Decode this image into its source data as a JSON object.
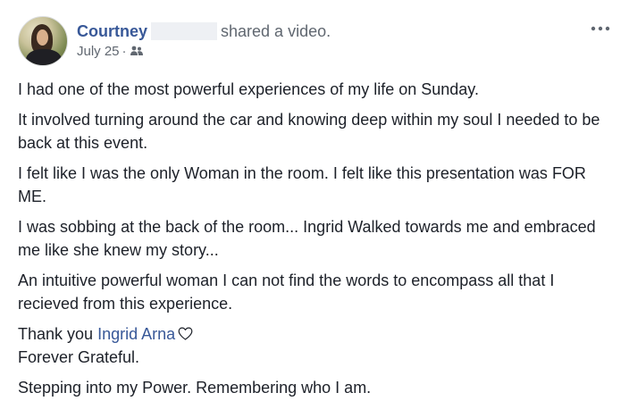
{
  "post": {
    "author": "Courtney",
    "action": "shared a video.",
    "date": "July 25",
    "date_separator": "·",
    "audience_icon": "friends-icon",
    "more_icon": "more-options-icon",
    "paragraphs": [
      "I had one of the most powerful experiences of my life on Sunday.",
      "It involved turning around the car and knowing deep within my soul I needed to be back at this event.",
      "I felt like I was the only Woman in the room. I felt like this presentation was FOR ME.",
      "I was sobbing at the back of the room... Ingrid Walked towards me and embraced me like she knew my story...",
      "An intuitive powerful woman I can not find the words to encompass all that I recieved from this experience."
    ],
    "thanks_prefix": "Thank you",
    "mention": "Ingrid Arna",
    "heart_icon": "heart-outline-icon",
    "closing_line": "Forever Grateful.",
    "final_line": "Stepping into my Power. Remembering who I am."
  },
  "colors": {
    "link": "#385898",
    "text": "#1d2129",
    "meta": "#606770"
  }
}
